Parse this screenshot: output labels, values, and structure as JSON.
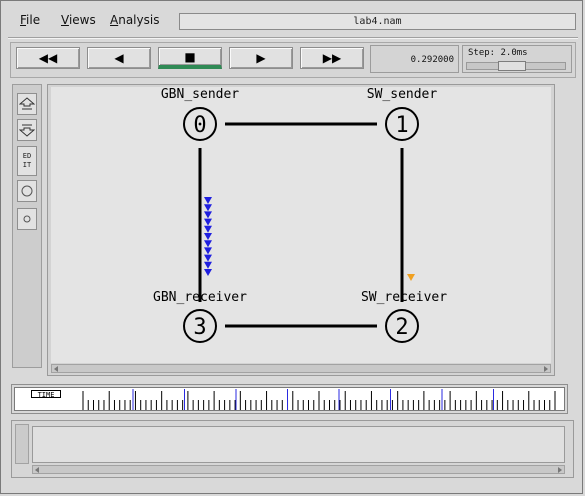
{
  "menu": [
    {
      "key": "F",
      "rest": "ile"
    },
    {
      "key": "V",
      "rest": "iews"
    },
    {
      "key": "A",
      "rest": "nalysis"
    }
  ],
  "window_title": "lab4.nam",
  "toolbar": {
    "rewind": "◀◀",
    "back": "◀",
    "stop": "■",
    "play": "▶",
    "fast_forward": "▶▶",
    "current_time": "0.292000",
    "step_label": "Step: 2.0ms",
    "step_slider_fraction": 0.45
  },
  "palette": {
    "edit_line1": "ED",
    "edit_line2": "IT"
  },
  "nodes": [
    {
      "id": "0",
      "label": "GBN_sender"
    },
    {
      "id": "1",
      "label": "SW_sender"
    },
    {
      "id": "2",
      "label": "SW_receiver"
    },
    {
      "id": "3",
      "label": "GBN_receiver"
    }
  ],
  "links": [
    [
      "0",
      "1"
    ],
    [
      "1",
      "2"
    ],
    [
      "2",
      "3"
    ],
    [
      "3",
      "0"
    ]
  ],
  "packets": {
    "gbn_color": "#1f1fe0",
    "gbn_count": 11,
    "sw_color": "#f0a020",
    "sw_count": 1
  },
  "timeline": {
    "label": "TIME",
    "major_ticks": 8
  }
}
